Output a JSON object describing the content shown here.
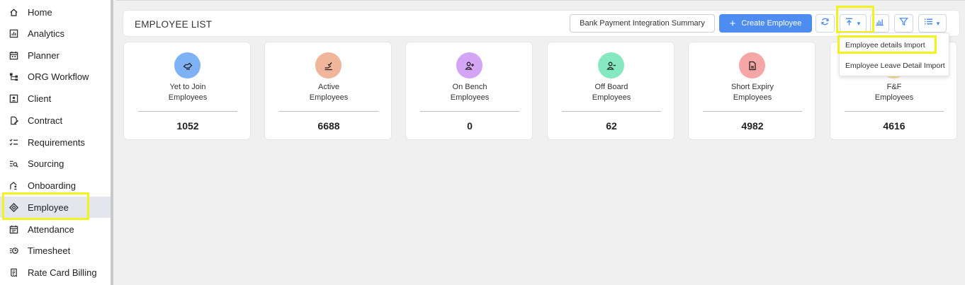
{
  "sidebar": {
    "items": [
      {
        "label": "Home",
        "icon": "home-icon"
      },
      {
        "label": "Analytics",
        "icon": "analytics-icon"
      },
      {
        "label": "Planner",
        "icon": "calendar-icon"
      },
      {
        "label": "ORG Workflow",
        "icon": "workflow-icon"
      },
      {
        "label": "Client",
        "icon": "client-icon"
      },
      {
        "label": "Contract",
        "icon": "contract-icon"
      },
      {
        "label": "Requirements",
        "icon": "checklist-icon"
      },
      {
        "label": "Sourcing",
        "icon": "search-list-icon"
      },
      {
        "label": "Onboarding",
        "icon": "onboarding-icon"
      },
      {
        "label": "Employee",
        "icon": "employee-icon",
        "active": true
      },
      {
        "label": "Attendance",
        "icon": "attendance-icon"
      },
      {
        "label": "Timesheet",
        "icon": "timesheet-icon"
      },
      {
        "label": "Rate Card Billing",
        "icon": "billing-icon"
      }
    ]
  },
  "header": {
    "title": "EMPLOYEE LIST",
    "bank_button": "Bank Payment Integration Summary",
    "create_button": "Create Employee",
    "create_icon": "+"
  },
  "dropdown": {
    "items": [
      "Employee details Import",
      "Employee Leave Detail Import"
    ]
  },
  "cards": [
    {
      "line1": "Yet to Join",
      "line2": "Employees",
      "value": "1052",
      "color": "#7fb2f5",
      "icon": "handshake-icon"
    },
    {
      "line1": "Active",
      "line2": "Employees",
      "value": "6688",
      "color": "#f0b59a",
      "icon": "hand-check-icon"
    },
    {
      "line1": "On Bench",
      "line2": "Employees",
      "value": "0",
      "color": "#d4a4f5",
      "icon": "user-plus-icon"
    },
    {
      "line1": "Off Board",
      "line2": "Employees",
      "value": "62",
      "color": "#86e8c0",
      "icon": "user-minus-icon"
    },
    {
      "line1": "Short Expiry",
      "line2": "Employees",
      "value": "4982",
      "color": "#f5a6a6",
      "icon": "document-icon"
    },
    {
      "line1": "F&F",
      "line2": "Employees",
      "value": "4616",
      "color": "#f5dca0",
      "icon": "settlement-icon"
    }
  ],
  "colors": {
    "accent": "#4d8cf0",
    "highlight": "#f2f21e",
    "sidebar_active": "#e3e6ec"
  }
}
